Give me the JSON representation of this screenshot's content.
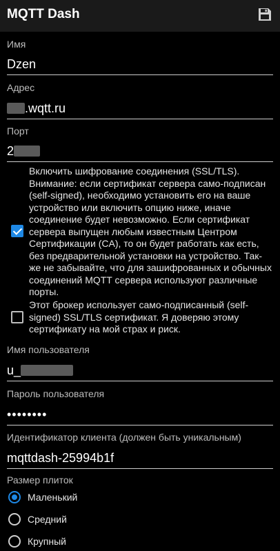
{
  "app": {
    "title": "MQTT Dash",
    "save_icon": "save-icon"
  },
  "fields": {
    "name": {
      "label": "Имя",
      "value": "Dzen"
    },
    "address": {
      "label": "Адрес",
      "value_suffix": ".wqtt.ru"
    },
    "port": {
      "label": "Порт",
      "value_prefix": "2"
    },
    "username": {
      "label": "Имя пользователя",
      "value_prefix": "u_"
    },
    "password": {
      "label": "Пароль пользователя",
      "value": "••••••••"
    },
    "client_id": {
      "label": "Идентификатор клиента (должен быть уникальным)",
      "value": "mqttdash-25994b1f"
    }
  },
  "options": {
    "ssl": {
      "checked": true,
      "text": "Включить шифрование соединения (SSL/TLS). Внимание: если сертификат сервера само-подписан (self-signed), необходимо установить его на ваше устройство или включить опцию ниже, иначе соединение будет невозможно. Если сертификат сервера выпущен любым известным Центром Сертификации (CA), то он будет работать как есть, без предварительной установки на устройство. Так-же не забывайте, что для зашифрованных и обычных соединений MQTT сервера используют различные порты."
    },
    "self_signed": {
      "checked": false,
      "text": "Этот брокер использует само-подписанный (self-signed) SSL/TLS сертификат. Я доверяю этому сертификату на мой страх и риск."
    }
  },
  "tile_size": {
    "label": "Размер плиток",
    "selected": "Маленький",
    "options": [
      "Маленький",
      "Средний",
      "Крупный"
    ]
  },
  "colors": {
    "accent": "#1e88e5",
    "background": "#000000",
    "appbar": "#1a1a1a"
  }
}
